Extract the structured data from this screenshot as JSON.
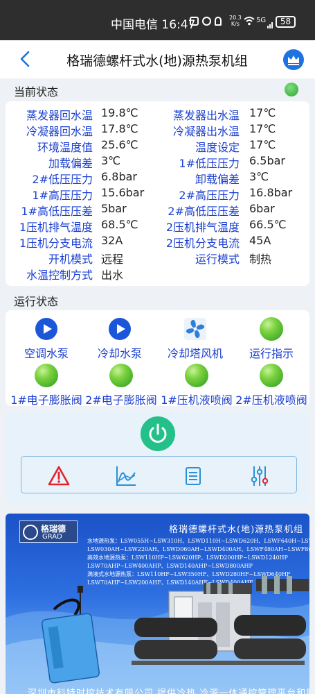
{
  "status_bar": {
    "carrier_time": "中国电信 16:47",
    "net_speed_value": "20.3",
    "net_speed_unit": "K/s",
    "signal": "5G",
    "battery": "58"
  },
  "header": {
    "title": "格瑞德螺杆式水(地)源热泵机组",
    "back_icon": "chevron-left-icon",
    "crown_icon": "crown-icon"
  },
  "current_status": {
    "heading": "当前状态",
    "indicator_color": "#2ea52e",
    "rows": [
      {
        "label1": "蒸发器回水温",
        "value1": "19.8℃",
        "label2": "蒸发器出水温",
        "value2": "17℃"
      },
      {
        "label1": "冷凝器回水温",
        "value1": "17.8℃",
        "label2": "冷凝器出水温",
        "value2": "17℃"
      },
      {
        "label1": "环境温度值",
        "value1": "25.6℃",
        "label2": "温度设定",
        "value2": "17℃"
      },
      {
        "label1": "加载偏差",
        "value1": "3℃",
        "label2": "1#低压压力",
        "value2": "6.5bar"
      },
      {
        "label1": "2#低压压力",
        "value1": "6.8bar",
        "label2": "卸载偏差",
        "value2": "3℃"
      },
      {
        "label1": "1#高压压力",
        "value1": "15.6bar",
        "label2": "2#高压压力",
        "value2": "16.8bar"
      },
      {
        "label1": "1#高低压压差",
        "value1": "5bar",
        "label2": "2#高低压压差",
        "value2": "6bar"
      },
      {
        "label1": "1压机排气温度",
        "value1": "68.5℃",
        "label2": "2压机排气温度",
        "value2": "66.5℃"
      },
      {
        "label1": "1压机分支电流",
        "value1": "32A",
        "label2": "2压机分支电流",
        "value2": "45A"
      },
      {
        "label1": "开机模式",
        "value1": "远程",
        "label2": "运行模式",
        "value2": "制热"
      },
      {
        "label1": "水温控制方式",
        "value1": "出水"
      }
    ]
  },
  "run_status": {
    "heading": "运行状态",
    "items": [
      {
        "label": "空调水泵",
        "icon": "play-icon"
      },
      {
        "label": "冷却水泵",
        "icon": "play-icon"
      },
      {
        "label": "冷却塔风机",
        "icon": "fan-icon"
      },
      {
        "label": "运行指示",
        "icon": "status-light-icon"
      },
      {
        "label": "1#电子膨胀阀",
        "icon": "status-light-icon"
      },
      {
        "label": "2#电子膨胀阀",
        "icon": "status-light-icon"
      },
      {
        "label": "1#压机液喷阀",
        "icon": "status-light-icon"
      },
      {
        "label": "2#压机液喷阀",
        "icon": "status-light-icon"
      }
    ]
  },
  "controls": {
    "power_icon": "power-icon",
    "power_color": "#24c08a",
    "tools": [
      "warning-icon",
      "chart-icon",
      "list-icon",
      "sliders-icon"
    ],
    "tool_color": "#2a8fd6",
    "warning_color": "#e0242a"
  },
  "banner": {
    "logo_cn": "格瑞德",
    "logo_en": "GRAD",
    "title": "格瑞德螺杆式水(地)源热泵机组",
    "lines": [
      "水地源热泵：LSW055H~LSW310H、LSWD110H~LSWD620H、LSWF640H~LSWF1040H",
      "LSW030AH~LSW220AH、LSWD060AH~LSWD400AH、LSWF480AH~LSWF800AH",
      "高效水地源热泵：LSW110HP~LSW620HP、LSWD200HP~LSWD1240HP",
      "LSW70AHP~LSW400AHP、LSWD140AHP~LSWD800AHP",
      "满液式水地源热泵：LSW110HF~LSW350HF、LSWD280HF~LSWD640HF",
      "LSW70AHF~LSW200AHF、LSWD140AHF~LSWD400AHF"
    ],
    "footer": "深圳市科特时控技术有限公司 提供冷热 冷源一体通控管理平台和服务"
  }
}
